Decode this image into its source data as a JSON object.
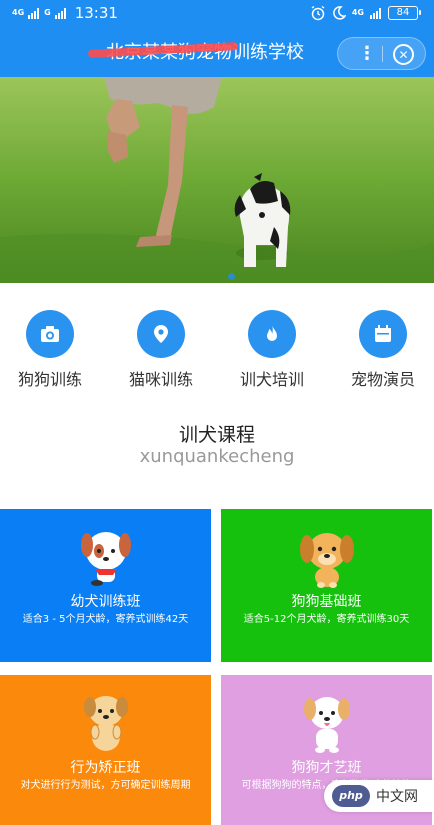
{
  "status_bar": {
    "network_left": "4G",
    "network_right": "4G",
    "time": "13:31",
    "battery": "84"
  },
  "header": {
    "title": "北京某某狗宠物训练学校",
    "more_icon": "more-dots-icon",
    "close_icon": "close-circle-icon",
    "background": "#1e8ef2"
  },
  "banner": {
    "image": "man-running-with-puppy-on-grass"
  },
  "categories": [
    {
      "label": "狗狗训练",
      "icon": "camera-icon"
    },
    {
      "label": "猫咪训练",
      "icon": "location-pin-icon"
    },
    {
      "label": "训犬培训",
      "icon": "flame-icon"
    },
    {
      "label": "宠物演员",
      "icon": "calendar-icon"
    }
  ],
  "section": {
    "title": "训犬课程",
    "subtitle": "xunquankecheng"
  },
  "courses": [
    {
      "name": "幼犬训练班",
      "desc": "适合3 - 5个月犬龄，寄养式训练42天",
      "color": "#0a7ff5",
      "icon": "puppy-cartoon-icon"
    },
    {
      "name": "狗狗基础班",
      "desc": "适合5-12个月犬龄，寄养式训练30天",
      "color": "#16c10e",
      "icon": "dog-cartoon-icon"
    },
    {
      "name": "行为矫正班",
      "desc": "对犬进行行为测试，方可确定训练周期",
      "color": "#fb8a0c",
      "icon": "dog-sitting-cartoon-icon"
    },
    {
      "name": "狗狗才艺班",
      "desc": "可根据狗狗的特点，定制狗狗才艺技能",
      "color": "#df9fe1",
      "icon": "white-dog-cartoon-icon"
    }
  ],
  "watermark": {
    "badge": "php",
    "text": "中文网"
  }
}
